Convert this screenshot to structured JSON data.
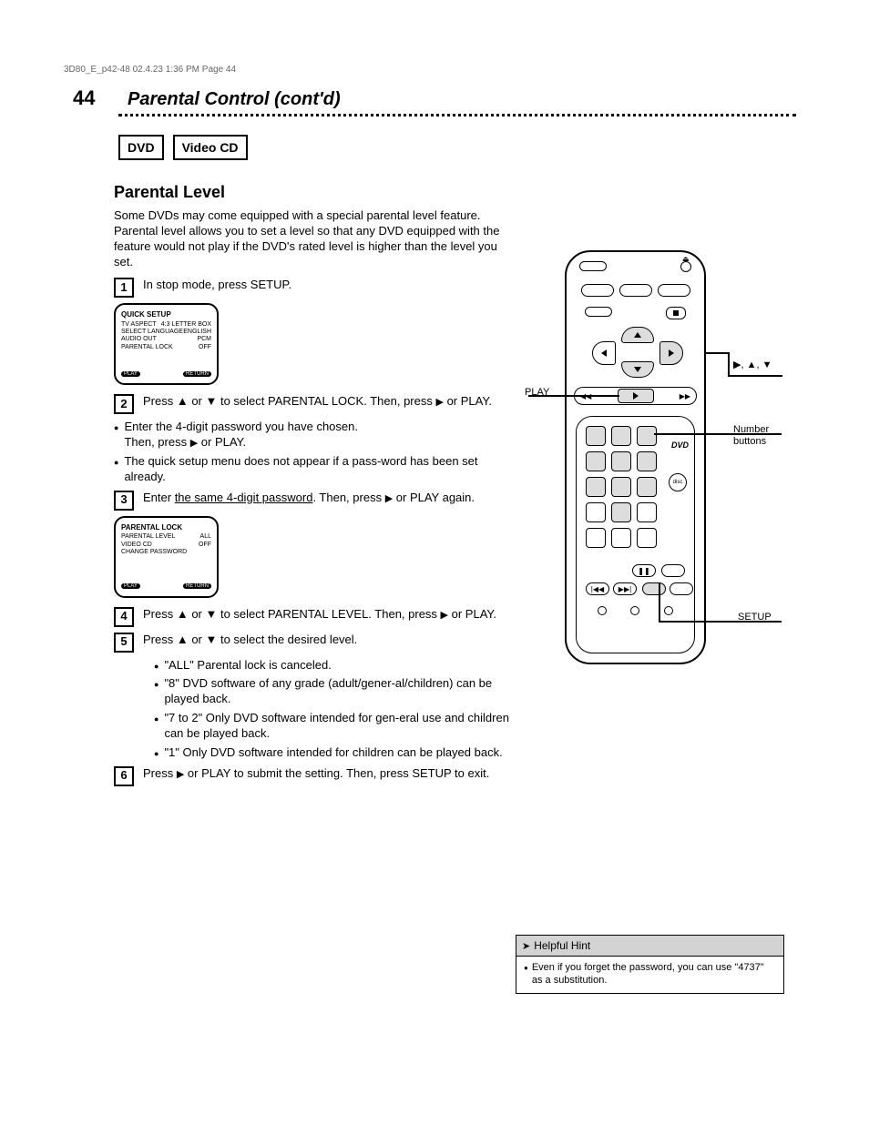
{
  "page": {
    "number": "44",
    "title": "Parental Control (cont'd)"
  },
  "tags": [
    "DVD",
    "Video CD"
  ],
  "section": {
    "heading": "Parental Level",
    "intro": "Some DVDs may come equipped with a special parental level feature. Parental level allows you to set a level so that any DVD equipped with the feature would not play if the DVD's rated level is higher than the level you set."
  },
  "steps": {
    "s1": {
      "num": "1",
      "text": "In stop mode, press SETUP."
    },
    "screen1": {
      "title": "QUICK SETUP",
      "lines": [
        "TV ASPECT",
        "SELECT LANGUAGE",
        "AUDIO OUT",
        "PARENTAL LOCK"
      ],
      "vals": [
        "4:3 LETTER BOX",
        "ENGLISH",
        "PCM",
        "OFF"
      ],
      "foot_play": "PLAY",
      "foot_ret": "RETURN"
    },
    "s2": {
      "num": "2",
      "text_a": "Press ▲ or ▼ to select PARENTAL LOCK. Then, press ",
      "text_b": " or PLAY."
    },
    "s2b": "Enter the 4-digit password you have chosen. Then, press ▶ or PLAY.",
    "s2c": "The quick setup menu does not appear if a pass-word has been set already.",
    "s3": {
      "num": "3",
      "text_a": "Enter ",
      "bold": "the same 4-digit password",
      "text_b": ". Then, press ",
      "text_c": " or PLAY again."
    },
    "screen2": {
      "title": "PARENTAL LOCK",
      "lines": [
        "PARENTAL LEVEL",
        "VIDEO CD",
        "CHANGE PASSWORD"
      ],
      "vals": [
        "ALL",
        "OFF",
        ""
      ],
      "foot_play": "PLAY",
      "foot_ret": "RETURN"
    },
    "s4": {
      "num": "4",
      "text_a": "Press ▲ or ▼ to select PARENTAL LEVEL. Then, press ",
      "text_b": " or PLAY."
    },
    "s5": {
      "num": "5",
      "text": "Press ▲ or ▼ to select the desired level."
    },
    "s5bullets": [
      "\"ALL\" Parental lock is canceled.",
      "\"8\" DVD software of any grade (adult/gener-al/children) can be played back.",
      "\"7 to 2\" Only DVD software intended for gen-eral use and children can be played back.",
      "\"1\" Only DVD software intended for children can be played back."
    ],
    "s6": {
      "num": "6",
      "text_a": "Press ",
      "text_b": " or PLAY to submit the setting. Then, press SETUP to exit."
    }
  },
  "callouts": {
    "arrows": "▶, ▲, ▼",
    "numbers": "Number buttons",
    "play": "PLAY",
    "setup": "SETUP"
  },
  "hint": {
    "head": "Helpful Hint",
    "body": "Even if you forget the password, you can use \"4737\" as a substitution."
  },
  "footer": "3D80_E_p42-48  02.4.23  1:36 PM  Page 44"
}
